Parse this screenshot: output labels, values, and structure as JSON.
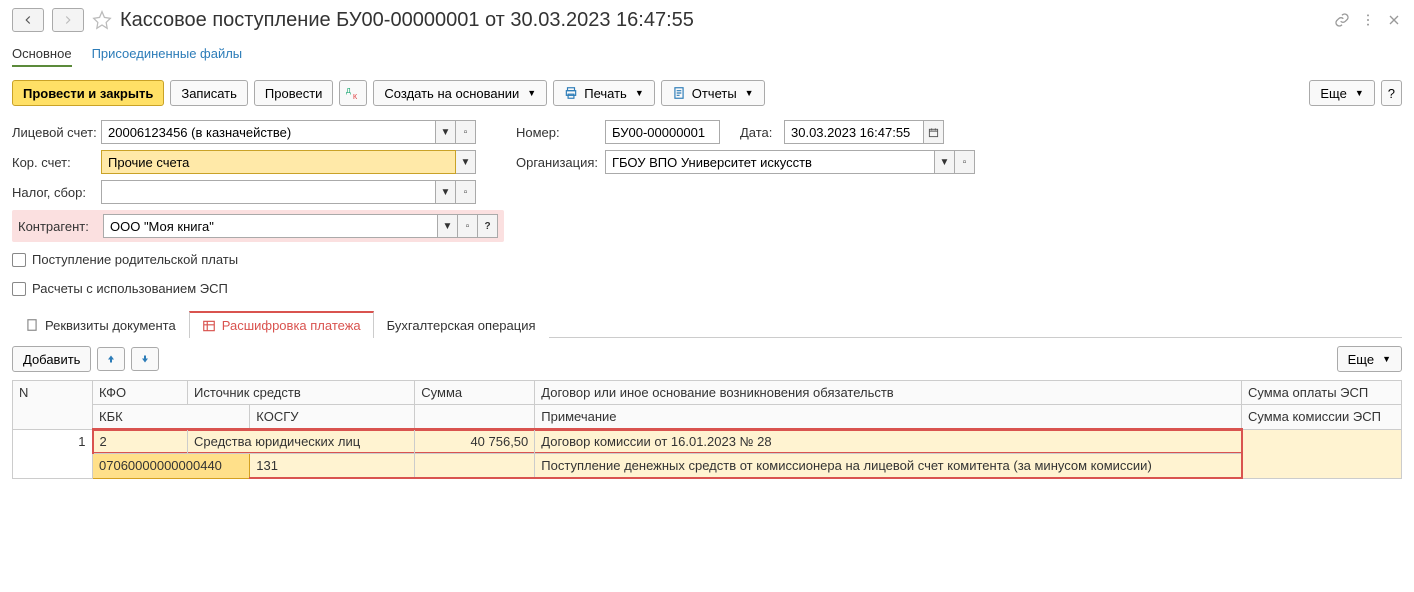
{
  "header": {
    "title": "Кассовое поступление БУ00-00000001 от 30.03.2023 16:47:55"
  },
  "sectionTabs": {
    "main": "Основное",
    "files": "Присоединенные файлы"
  },
  "toolbar": {
    "postClose": "Провести и закрыть",
    "write": "Записать",
    "post": "Провести",
    "createBased": "Создать на основании",
    "print": "Печать",
    "reports": "Отчеты",
    "more": "Еще"
  },
  "form": {
    "accountLabel": "Лицевой счет:",
    "accountValue": "20006123456 (в казначействе)",
    "corLabel": "Кор. счет:",
    "corValue": "Прочие счета",
    "taxLabel": "Налог, сбор:",
    "taxValue": "",
    "counterLabel": "Контрагент:",
    "counterValue": "ООО \"Моя книга\"",
    "numberLabel": "Номер:",
    "numberValue": "БУ00-00000001",
    "dateLabel": "Дата:",
    "dateValue": "30.03.2023 16:47:55",
    "orgLabel": "Организация:",
    "orgValue": "ГБОУ ВПО Университет искусств",
    "parentPay": "Поступление родительской платы",
    "esp": "Расчеты с использованием ЭСП"
  },
  "innerTabs": {
    "req": "Реквизиты документа",
    "detail": "Расшифровка платежа",
    "acc": "Бухгалтерская операция"
  },
  "tabToolbar": {
    "add": "Добавить",
    "more": "Еще"
  },
  "gridHead": {
    "n": "N",
    "kfo": "КФО",
    "src": "Источник средств",
    "sum": "Сумма",
    "contract": "Договор или иное основание возникновения обязательств",
    "espSum": "Сумма оплаты ЭСП",
    "kbk": "КБК",
    "kosgu": "КОСГУ",
    "note": "Примечание",
    "espComm": "Сумма комиссии ЭСП"
  },
  "row": {
    "n": "1",
    "kfo": "2",
    "src": "Средства юридических лиц",
    "sum": "40 756,50",
    "contract": "Договор комиссии от 16.01.2023 № 28",
    "kbk": "07060000000000440",
    "kosgu": "131",
    "note": "Поступление денежных средств от комиссионера на лицевой счет комитента (за минусом комиссии)"
  }
}
